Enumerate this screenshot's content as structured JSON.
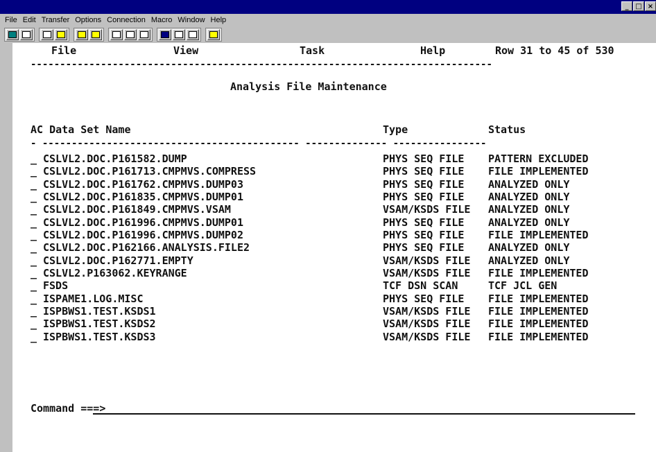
{
  "window": {
    "controls": [
      "minimize-icon",
      "restore-icon",
      "close-icon"
    ],
    "control_glyphs": [
      "_",
      "□",
      "×"
    ]
  },
  "menubar": [
    "File",
    "Edit",
    "Transfer",
    "Options",
    "Connection",
    "Macro",
    "Window",
    "Help"
  ],
  "toolbar": {
    "icons": [
      "display-icon",
      "print-icon",
      "copy-icon",
      "paste-icon",
      "send-file-icon",
      "receive-file-icon",
      "macro-icon",
      "font-down-icon",
      "font-up-icon",
      "session-icon",
      "edit-icon",
      "clear-icon",
      "help-icon"
    ]
  },
  "terminal": {
    "menu": [
      "File",
      "View",
      "Task",
      "Help"
    ],
    "row_info": "Row 31 to 45 of 530",
    "separator": "-------------------------------------------------------------------------------",
    "title": "Analysis File Maintenance",
    "headers": {
      "name": "AC Data Set Name",
      "type": "Type",
      "status": "Status"
    },
    "header_rule": "- -------------------------------------------- -------------- ----------------",
    "rows": [
      {
        "sel": "_",
        "name": "CSLVL2.DOC.P161582.DUMP",
        "type": "PHYS SEQ FILE",
        "status": "PATTERN EXCLUDED"
      },
      {
        "sel": "_",
        "name": "CSLVL2.DOC.P161713.CMPMVS.COMPRESS",
        "type": "PHYS SEQ FILE",
        "status": "FILE IMPLEMENTED"
      },
      {
        "sel": "_",
        "name": "CSLVL2.DOC.P161762.CMPMVS.DUMP03",
        "type": "PHYS SEQ FILE",
        "status": "ANALYZED ONLY"
      },
      {
        "sel": "_",
        "name": "CSLVL2.DOC.P161835.CMPMVS.DUMP01",
        "type": "PHYS SEQ FILE",
        "status": "ANALYZED ONLY"
      },
      {
        "sel": "_",
        "name": "CSLVL2.DOC.P161849.CMPMVS.VSAM",
        "type": "VSAM/KSDS FILE",
        "status": "ANALYZED ONLY"
      },
      {
        "sel": "_",
        "name": "CSLVL2.DOC.P161996.CMPMVS.DUMP01",
        "type": "PHYS SEQ FILE",
        "status": "ANALYZED ONLY"
      },
      {
        "sel": "_",
        "name": "CSLVL2.DOC.P161996.CMPMVS.DUMP02",
        "type": "PHYS SEQ FILE",
        "status": "FILE IMPLEMENTED"
      },
      {
        "sel": "_",
        "name": "CSLVL2.DOC.P162166.ANALYSIS.FILE2",
        "type": "PHYS SEQ FILE",
        "status": "ANALYZED ONLY"
      },
      {
        "sel": "_",
        "name": "CSLVL2.DOC.P162771.EMPTY",
        "type": "VSAM/KSDS FILE",
        "status": "ANALYZED ONLY"
      },
      {
        "sel": "_",
        "name": "CSLVL2.P163062.KEYRANGE",
        "type": "VSAM/KSDS FILE",
        "status": "FILE IMPLEMENTED"
      },
      {
        "sel": "_",
        "name": "FSDS",
        "type": "TCF DSN SCAN",
        "status": "TCF JCL GEN"
      },
      {
        "sel": "_",
        "name": "ISPAME1.LOG.MISC",
        "type": "PHYS SEQ FILE",
        "status": "FILE IMPLEMENTED"
      },
      {
        "sel": "_",
        "name": "ISPBWS1.TEST.KSDS1",
        "type": "VSAM/KSDS FILE",
        "status": "FILE IMPLEMENTED"
      },
      {
        "sel": "_",
        "name": "ISPBWS1.TEST.KSDS2",
        "type": "VSAM/KSDS FILE",
        "status": "FILE IMPLEMENTED"
      },
      {
        "sel": "_",
        "name": "ISPBWS1.TEST.KSDS3",
        "type": "VSAM/KSDS FILE",
        "status": "FILE IMPLEMENTED"
      }
    ],
    "command_label": "Command ===>",
    "command_value": ""
  }
}
